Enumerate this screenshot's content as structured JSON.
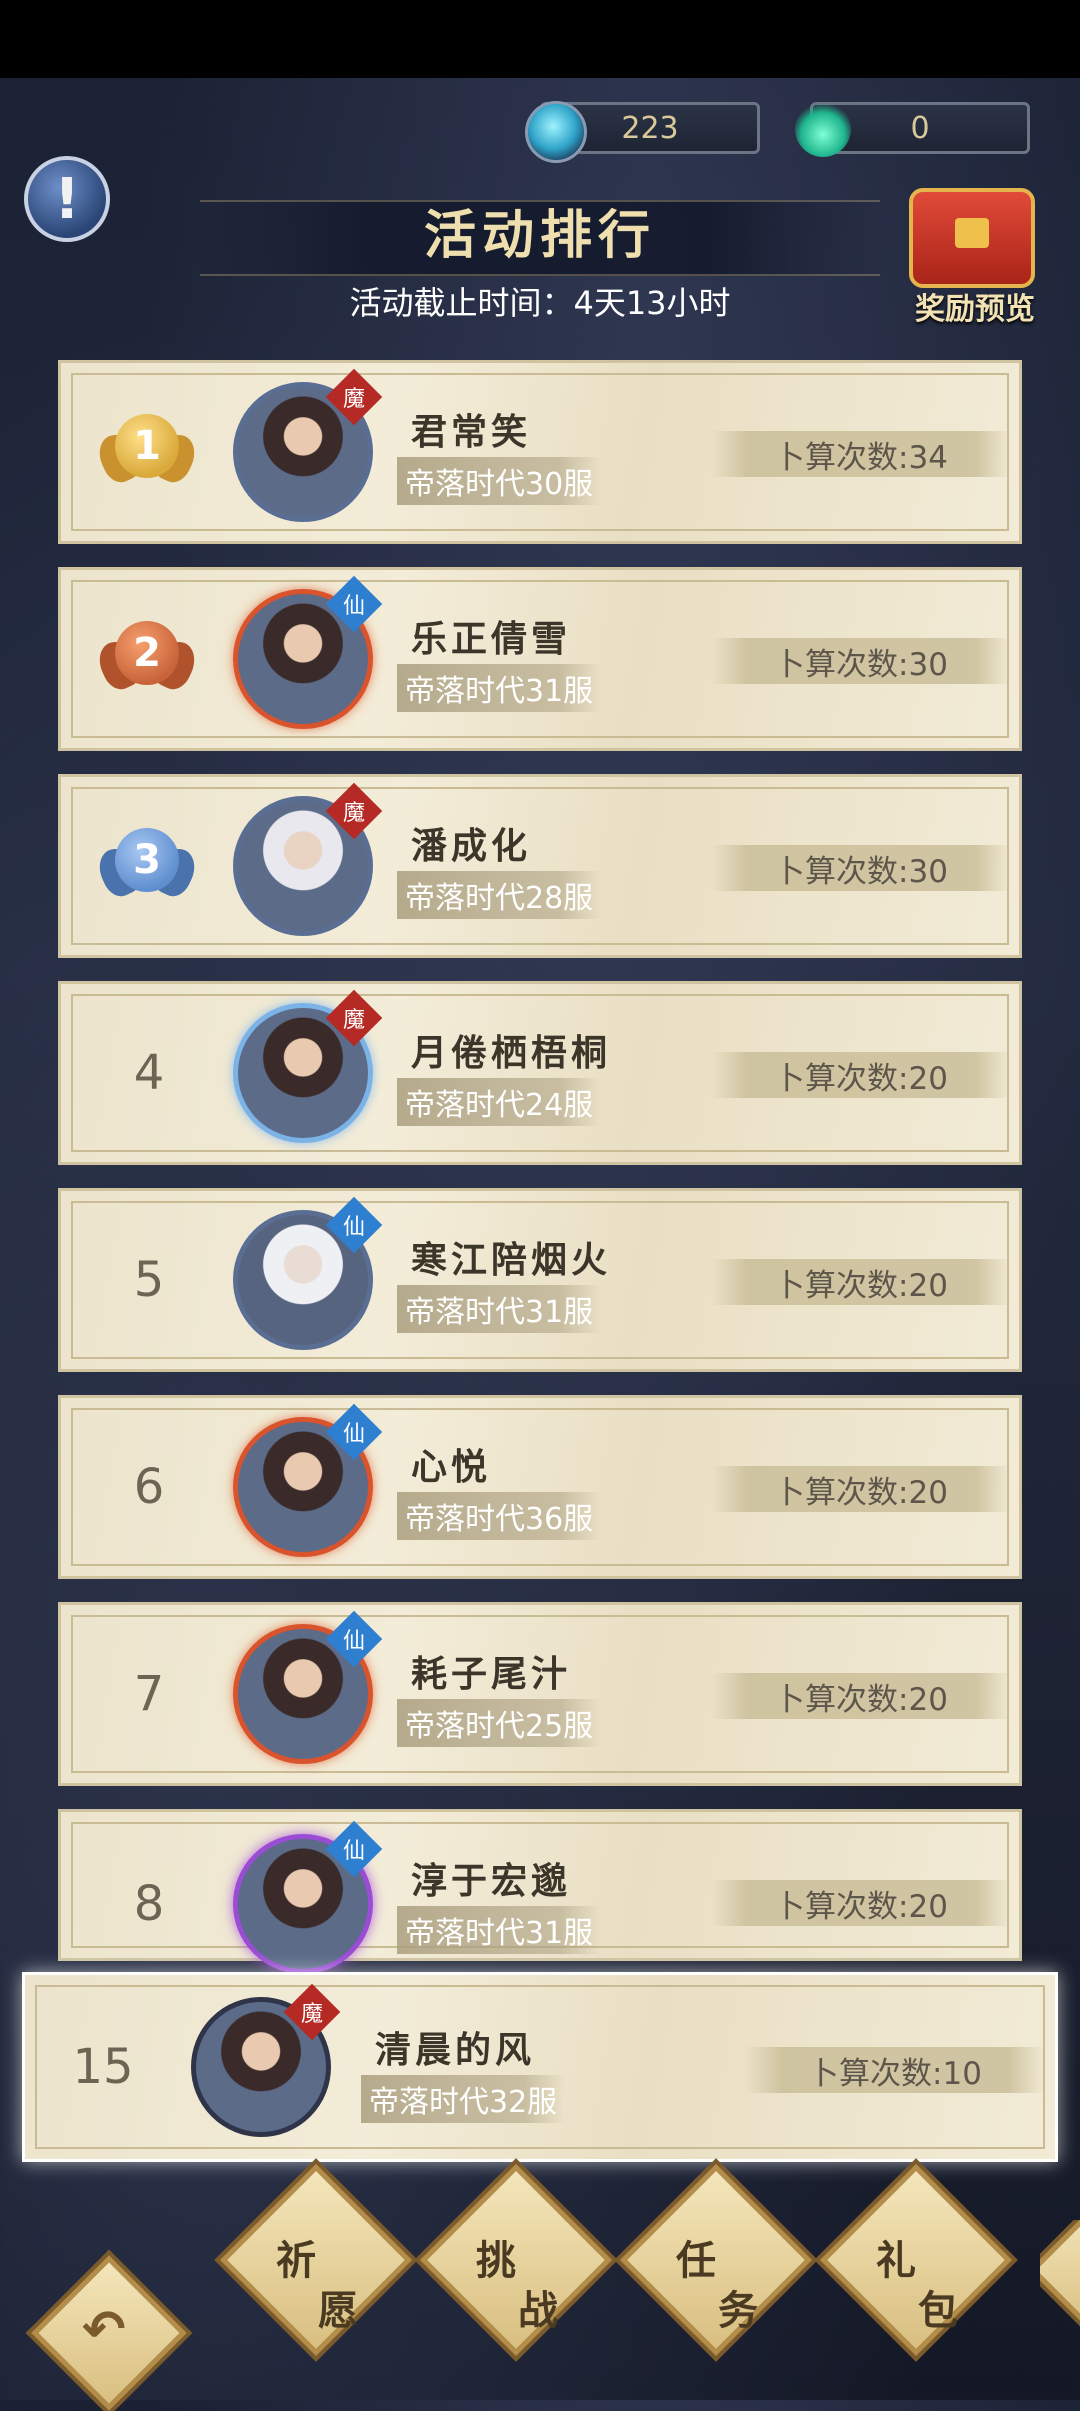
{
  "currencies": [
    {
      "name": "blue-orb-currency",
      "value": "223"
    },
    {
      "name": "green-flame-currency",
      "value": "0"
    }
  ],
  "header": {
    "title": "活动排行",
    "deadline": "活动截止时间：4天13小时",
    "reward_preview_label": "奖励预览"
  },
  "ranking": [
    {
      "rank": "1",
      "medal": "gold",
      "name": "君常笑",
      "server": "帝落时代30服",
      "count": "卜算次数:34",
      "faction": "魔"
    },
    {
      "rank": "2",
      "medal": "bronze",
      "name": "乐正倩雪",
      "server": "帝落时代31服",
      "count": "卜算次数:30",
      "faction": "仙"
    },
    {
      "rank": "3",
      "medal": "blue",
      "name": "潘成化",
      "server": "帝落时代28服",
      "count": "卜算次数:30",
      "faction": "魔"
    },
    {
      "rank": "4",
      "name": "月倦栖梧桐",
      "server": "帝落时代24服",
      "count": "卜算次数:20",
      "faction": "魔"
    },
    {
      "rank": "5",
      "name": "寒江陪烟火",
      "server": "帝落时代31服",
      "count": "卜算次数:20",
      "faction": "仙"
    },
    {
      "rank": "6",
      "name": "心悦",
      "server": "帝落时代36服",
      "count": "卜算次数:20",
      "faction": "仙"
    },
    {
      "rank": "7",
      "name": "耗子尾汁",
      "server": "帝落时代25服",
      "count": "卜算次数:20",
      "faction": "仙"
    },
    {
      "rank": "8",
      "name": "淳于宏邈",
      "server": "帝落时代31服",
      "count": "卜算次数:20",
      "faction": "仙"
    }
  ],
  "my_rank": {
    "rank": "15",
    "name": "清晨的风",
    "server": "帝落时代32服",
    "count": "卜算次数:10",
    "faction": "魔"
  },
  "nav": [
    {
      "c1": "祈",
      "c2": "愿"
    },
    {
      "c1": "挑",
      "c2": "战"
    },
    {
      "c1": "任",
      "c2": "务"
    },
    {
      "c1": "礼",
      "c2": "包"
    }
  ],
  "colors": {
    "gold": "#d9a93a",
    "bronze": "#c9643a",
    "blue": "#5f8fd0"
  }
}
